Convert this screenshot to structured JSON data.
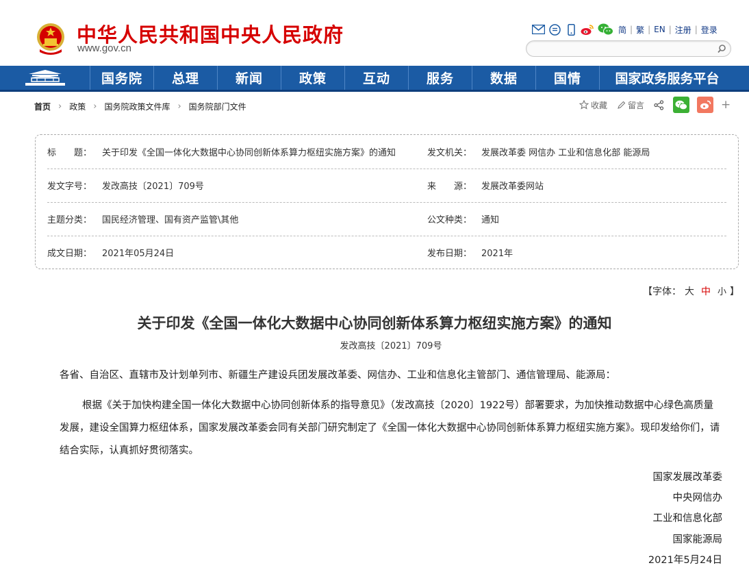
{
  "header": {
    "site_name": "中华人民共和国中央人民政府",
    "site_url": "www.gov.cn",
    "toplinks": [
      "简",
      "繁",
      "EN",
      "注册",
      "登录"
    ],
    "icons": [
      "mail-icon",
      "message-icon",
      "mobile-icon",
      "weibo-icon",
      "wechat-icon"
    ],
    "search_placeholder": ""
  },
  "nav": {
    "items": [
      "国务院",
      "总理",
      "新闻",
      "政策",
      "互动",
      "服务",
      "数据",
      "国情",
      "国家政务服务平台"
    ]
  },
  "breadcrumb": [
    "首页",
    "政策",
    "国务院政策文件库",
    "国务院部门文件"
  ],
  "tools": {
    "favorite": "收藏",
    "comment": "留言"
  },
  "meta": {
    "rows": [
      {
        "k1": "标　　题：",
        "v1": "关于印发《全国一体化大数据中心协同创新体系算力枢纽实施方案》的通知",
        "k2": "发文机关：",
        "v2": "发展改革委  网信办  工业和信息化部  能源局"
      },
      {
        "k1": "发文字号：",
        "v1": "发改高技〔2021〕709号",
        "k2": "来　　源：",
        "v2": "发展改革委网站"
      },
      {
        "k1": "主题分类：",
        "v1": "国民经济管理、国有资产监管\\其他",
        "k2": "公文种类：",
        "v2": "通知"
      },
      {
        "k1": "成文日期：",
        "v1": "2021年05月24日",
        "k2": "发布日期：",
        "v2": "2021年"
      }
    ]
  },
  "fontsize": {
    "open": "【字体：",
    "large": "大",
    "medium": "中",
    "small": "小",
    "close": "】"
  },
  "document": {
    "title": "关于印发《全国一体化大数据中心协同创新体系算力枢纽实施方案》的通知",
    "number": "发改高技〔2021〕709号",
    "salutation": "各省、自治区、直辖市及计划单列市、新疆生产建设兵团发展改革委、网信办、工业和信息化主管部门、通信管理局、能源局：",
    "paragraph": "根据《关于加快构建全国一体化大数据中心协同创新体系的指导意见》（发改高技〔2020〕1922号）部署要求，为加快推动数据中心绿色高质量发展，建设全国算力枢纽体系，国家发展改革委会同有关部门研究制定了《全国一体化大数据中心协同创新体系算力枢纽实施方案》。现印发给你们，请结合实际，认真抓好贯彻落实。",
    "signatures": [
      "国家发展改革委",
      "中央网信办",
      "工业和信息化部",
      "国家能源局"
    ],
    "date": "2021年5月24日"
  }
}
